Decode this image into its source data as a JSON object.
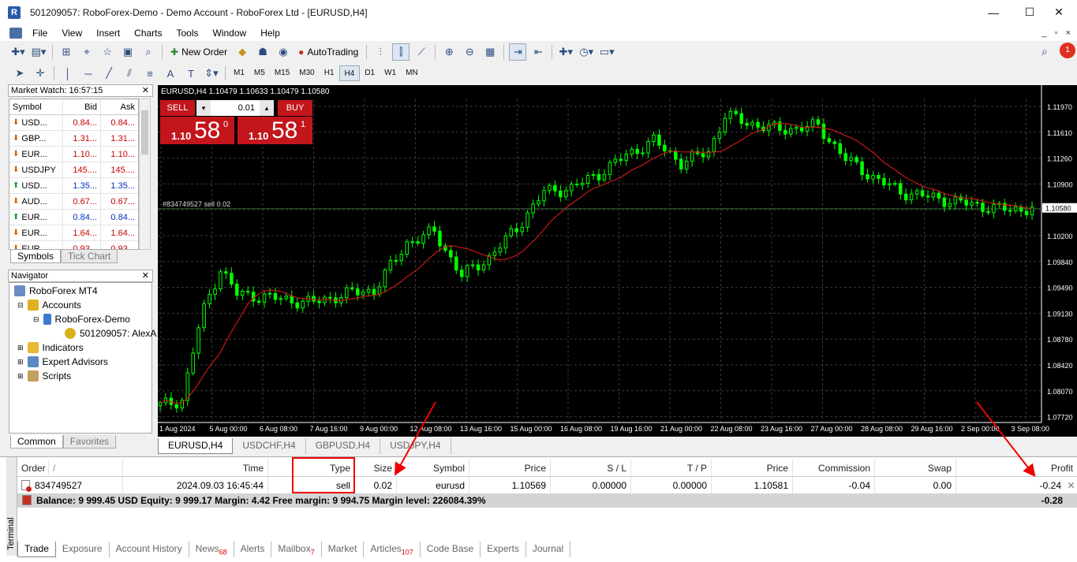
{
  "window": {
    "title": "501209057: RoboForex-Demo - Demo Account - RoboForex Ltd - [EURUSD,H4]",
    "app_icon": "roboforex-app-icon",
    "controls": [
      "—",
      "☐",
      "✕"
    ]
  },
  "menu": [
    "File",
    "View",
    "Insert",
    "Charts",
    "Tools",
    "Window",
    "Help"
  ],
  "mdi_controls": [
    "_",
    "▫",
    "×"
  ],
  "toolbar1": {
    "new_order": "New Order",
    "autotrading": "AutoTrading"
  },
  "timeframes": [
    "M1",
    "M5",
    "M15",
    "M30",
    "H1",
    "H4",
    "D1",
    "W1",
    "MN"
  ],
  "active_timeframe": "H4",
  "market_watch": {
    "title": "Market Watch: 16:57:15",
    "columns": [
      "Symbol",
      "Bid",
      "Ask"
    ],
    "rows": [
      {
        "symbol": "USD...",
        "bid": "0.84...",
        "ask": "0.84...",
        "dir": "down",
        "color": "red"
      },
      {
        "symbol": "GBP...",
        "bid": "1.31...",
        "ask": "1.31...",
        "dir": "down",
        "color": "red"
      },
      {
        "symbol": "EUR...",
        "bid": "1.10...",
        "ask": "1.10...",
        "dir": "down",
        "color": "red"
      },
      {
        "symbol": "USDJPY",
        "bid": "145....",
        "ask": "145....",
        "dir": "down",
        "color": "red"
      },
      {
        "symbol": "USD...",
        "bid": "1.35...",
        "ask": "1.35...",
        "dir": "up",
        "color": "blue"
      },
      {
        "symbol": "AUD...",
        "bid": "0.67...",
        "ask": "0.67...",
        "dir": "down",
        "color": "red"
      },
      {
        "symbol": "EUR...",
        "bid": "0.84...",
        "ask": "0.84...",
        "dir": "up",
        "color": "blue"
      },
      {
        "symbol": "EUR...",
        "bid": "1.64...",
        "ask": "1.64...",
        "dir": "down",
        "color": "red"
      },
      {
        "symbol": "EUR...",
        "bid": "0.93...",
        "ask": "0.93...",
        "dir": "down",
        "color": "red"
      }
    ],
    "tabs": [
      "Symbols",
      "Tick Chart"
    ]
  },
  "navigator": {
    "title": "Navigator",
    "items": [
      {
        "label": "RoboForex MT4",
        "icon": "terminal-icon"
      },
      {
        "label": "Accounts",
        "icon": "accounts-icon"
      },
      {
        "label": "RoboForex-Demo",
        "icon": "server-icon"
      },
      {
        "label": "501209057: AlexA",
        "icon": "user-icon"
      },
      {
        "label": "Indicators",
        "icon": "indicators-icon"
      },
      {
        "label": "Expert Advisors",
        "icon": "expert-advisors-icon"
      },
      {
        "label": "Scripts",
        "icon": "scripts-icon"
      }
    ],
    "tabs": [
      "Common",
      "Favorites"
    ]
  },
  "chart": {
    "header": "EURUSD,H4  1.10479 1.10633 1.10479 1.10580",
    "one_click": {
      "sell": "SELL",
      "buy": "BUY",
      "lot": "0.01",
      "sell_prefix": "1.10",
      "sell_big": "58",
      "sell_sup": "0",
      "buy_prefix": "1.10",
      "buy_big": "58",
      "buy_sup": "1"
    },
    "order_line_label": "#834749527 sell 0.02",
    "price_labels": [
      "1.11970",
      "1.11610",
      "1.11260",
      "1.10900",
      "1.10580",
      "1.10200",
      "1.09840",
      "1.09490",
      "1.09130",
      "1.08780",
      "1.08420",
      "1.08070",
      "1.07720"
    ],
    "current_price": "1.10580",
    "time_labels": [
      "1 Aug 2024",
      "5 Aug 00:00",
      "6 Aug 08:00",
      "7 Aug 16:00",
      "9 Aug 00:00",
      "12 Aug 08:00",
      "13 Aug 16:00",
      "15 Aug 00:00",
      "16 Aug 08:00",
      "19 Aug 16:00",
      "21 Aug 00:00",
      "22 Aug 08:00",
      "23 Aug 16:00",
      "27 Aug 00:00",
      "28 Aug 08:00",
      "29 Aug 16:00",
      "2 Sep 00:00",
      "3 Sep 08:00"
    ],
    "colors": {
      "background": "#000000",
      "grid": "#3a3a3a",
      "bull": "#00ff00",
      "bear": "#00ff00",
      "ma": "#c81818",
      "order_line": "#2f6b2f"
    }
  },
  "chart_tabs": [
    "EURUSD,H4",
    "USDCHF,H4",
    "GBPUSD,H4",
    "USDJPY,H4"
  ],
  "trade": {
    "columns": [
      "Order",
      "/",
      "Time",
      "Type",
      "Size",
      "Symbol",
      "Price",
      "S / L",
      "T / P",
      "Price",
      "Commission",
      "Swap",
      "Profit"
    ],
    "row": {
      "order": "834749527",
      "time": "2024.09.03 16:45:44",
      "type": "sell",
      "size": "0.02",
      "symbol": "eurusd",
      "price": "1.10569",
      "sl": "0.00000",
      "tp": "0.00000",
      "cur_price": "1.10581",
      "commission": "-0.04",
      "swap": "0.00",
      "profit": "-0.24"
    },
    "balance": "Balance: 9 999.45 USD  Equity: 9 999.17  Margin: 4.42  Free margin: 9 994.75  Margin level: 226084.39%",
    "total": "-0.28",
    "side_label": "Terminal"
  },
  "terminal_tabs": [
    {
      "label": "Trade",
      "badge": ""
    },
    {
      "label": "Exposure",
      "badge": ""
    },
    {
      "label": "Account History",
      "badge": ""
    },
    {
      "label": "News",
      "badge": "68"
    },
    {
      "label": "Alerts",
      "badge": ""
    },
    {
      "label": "Mailbox",
      "badge": "7"
    },
    {
      "label": "Market",
      "badge": ""
    },
    {
      "label": "Articles",
      "badge": "107"
    },
    {
      "label": "Code Base",
      "badge": ""
    },
    {
      "label": "Experts",
      "badge": ""
    },
    {
      "label": "Journal",
      "badge": ""
    }
  ]
}
